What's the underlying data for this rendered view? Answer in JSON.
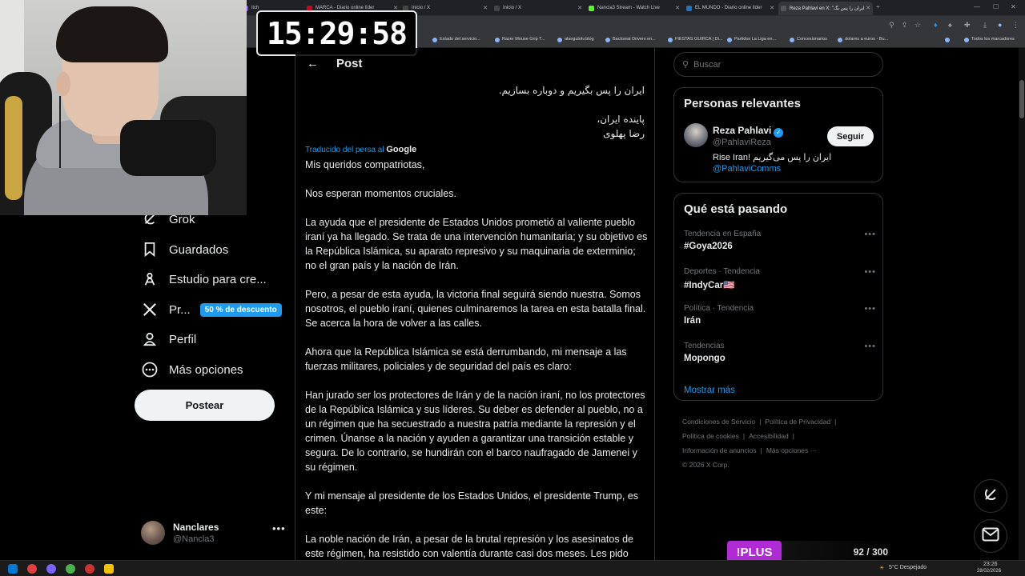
{
  "browser": {
    "tabs": [
      {
        "label": "itch",
        "color": "#9146ff"
      },
      {
        "label": "MARCA - Diario online líder",
        "color": "#d1001f"
      },
      {
        "label": "Inicio / X",
        "color": "#ffffff"
      },
      {
        "label": "Inicio / X",
        "color": "#ffffff"
      },
      {
        "label": "Nancla3 Stream - Watch Live",
        "color": "#53fc18"
      },
      {
        "label": "EL MUNDO - Diario online líder",
        "color": "#1e73be"
      },
      {
        "label": "Reza Pahlavi en X: \"ایران را پس بگ",
        "color": "#ffffff"
      }
    ],
    "new_tab_symbol": "+",
    "bookmarks": [
      "Estado del servicio...",
      "Razer Mouse Grip T...",
      "alangulotv.blog",
      "Backseat Drivers en...",
      "FIESTAS GUIRCA | Di...",
      "Partidos La Liga en...",
      "Concesionarios",
      "dolares a euros - Bu..."
    ],
    "all_bookmarks": "Todos los marcadores",
    "bookmarks_more": "»"
  },
  "overlay": {
    "clock": "15:29:58",
    "plus_label": "!PLUS",
    "plus_count": "92 / 300"
  },
  "nav": {
    "items": [
      {
        "label": "Grok",
        "icon": "grok-icon"
      },
      {
        "label": "Guardados",
        "icon": "bookmark-icon"
      },
      {
        "label": "Estudio para cre...",
        "icon": "creator-studio-icon"
      },
      {
        "label": "Pr...",
        "icon": "x-logo-icon",
        "badge": "50 % de descuento"
      },
      {
        "label": "Perfil",
        "icon": "profile-icon"
      },
      {
        "label": "Más opciones",
        "icon": "more-options-icon"
      }
    ],
    "post_button": "Postear",
    "profile": {
      "name": "Nanclares",
      "handle": "@Nancla3",
      "more": "•••"
    }
  },
  "post": {
    "back_symbol": "←",
    "header_title": "Post",
    "persian_lines": [
      "ایران را پس بگیریم و دوباره بسازیم.",
      "پاینده ایران،",
      "رضا پهلوی"
    ],
    "translated_label": "Traducido del persa al",
    "translated_brand": "Google",
    "paragraphs": [
      "Mis queridos compatriotas,",
      "Nos esperan momentos cruciales.",
      "La ayuda que el presidente de Estados Unidos prometió al valiente pueblo iraní ya ha llegado. Se trata de una intervención humanitaria; y su objetivo es la República Islámica, su aparato represivo y su maquinaria de exterminio; no el gran país y la nación de Irán.",
      "Pero, a pesar de esta ayuda, la victoria final seguirá siendo nuestra. Somos nosotros, el pueblo iraní, quienes culminaremos la tarea en esta batalla final. Se acerca la hora de volver a las calles.",
      "Ahora que la República Islámica se está derrumbando, mi mensaje a las fuerzas militares, policiales y de seguridad del país es claro:",
      "Han jurado ser los protectores de Irán y de la nación iraní, no los protectores de la República Islámica y sus líderes. Su deber es defender al pueblo, no a un régimen que ha secuestrado a nuestra patria mediante la represión y el crimen. Únanse a la nación y ayuden a garantizar una transición estable y segura. De lo contrario, se hundirán con el barco naufragado de Jamenei y su régimen.",
      "Y mi mensaje al presidente de los Estados Unidos, el presidente Trump, es este:",
      "La noble nación de Irán, a pesar de la brutal represión y los asesinatos de este régimen, ha resistido con valentía durante casi dos meses. Les pido"
    ]
  },
  "sidebar": {
    "search_placeholder": "Buscar",
    "relevant_title": "Personas relevantes",
    "relevant_person": {
      "name": "Reza Pahlavi",
      "verified_mark": "✓",
      "handle": "@PahlaviReza",
      "bio": "Rise Iran! ایران را پس می‌گیریم",
      "bio_link": "@PahlaviComms",
      "follow_label": "Seguir"
    },
    "trends_title": "Qué está pasando",
    "trends": [
      {
        "category": "Tendencia en España",
        "name": "#Goya2026"
      },
      {
        "category": "Deportes · Tendencia",
        "name": "#IndyCar🇺🇸"
      },
      {
        "category": "Política · Tendencia",
        "name": "Irán"
      },
      {
        "category": "Tendencias",
        "name": "Mopongo"
      }
    ],
    "trend_more": "•••",
    "show_more": "Mostrar más",
    "footer": [
      "Condiciones de Servicio",
      "Política de Privacidad",
      "Política de cookies",
      "Accesibilidad",
      "Información de anuncios",
      "Más opciones ···",
      "© 2026 X Corp."
    ],
    "footer_sep": "|"
  },
  "taskbar": {
    "weather": "5°C  Despejado",
    "time": "23:26",
    "date": "28/02/2026"
  },
  "colors": {
    "accent": "#1d9bf0",
    "plus": "#b02ad6",
    "border": "#2f3336"
  }
}
